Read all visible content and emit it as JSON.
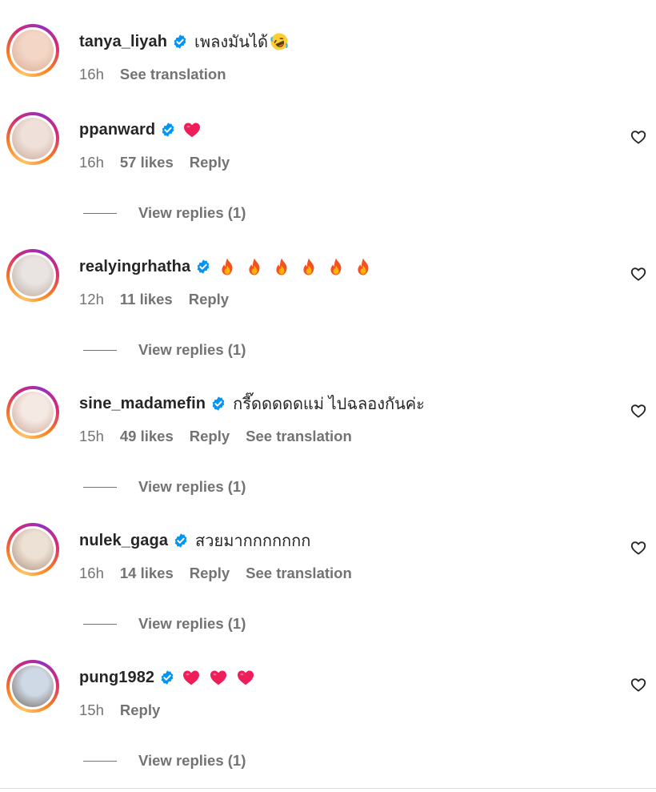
{
  "comments": [
    {
      "username": "tanya_liyah",
      "text": "เพลงมันได้",
      "emojis": [
        "rofl"
      ],
      "time": "16h",
      "likes": "",
      "reply": "",
      "translate": "See translation",
      "view_replies": "",
      "has_heart": false,
      "avatar_colors": [
        "#f3d6c6",
        "#d7a98e"
      ]
    },
    {
      "username": "ppanward",
      "text": "",
      "emojis": [
        "heart"
      ],
      "time": "16h",
      "likes": "57 likes",
      "reply": "Reply",
      "translate": "",
      "view_replies": "View replies (1)",
      "has_heart": true,
      "avatar_colors": [
        "#efe1d9",
        "#c8a396"
      ]
    },
    {
      "username": "realyingrhatha",
      "text": "",
      "emojis": [
        "fire",
        "fire",
        "fire",
        "fire",
        "fire",
        "fire"
      ],
      "time": "12h",
      "likes": "11 likes",
      "reply": "Reply",
      "translate": "",
      "view_replies": "View replies (1)",
      "has_heart": true,
      "avatar_colors": [
        "#e9e4e1",
        "#b9a69b"
      ]
    },
    {
      "username": "sine_madamefin",
      "text": "กรี๊ดดดดดแม่ ไปฉลองกันค่ะ",
      "emojis": [],
      "time": "15h",
      "likes": "49 likes",
      "reply": "Reply",
      "translate": "See translation",
      "view_replies": "View replies (1)",
      "has_heart": true,
      "avatar_colors": [
        "#f5e9e4",
        "#c9a28f"
      ]
    },
    {
      "username": "nulek_gaga",
      "text": "สวยมากกกกกกก",
      "emojis": [],
      "time": "16h",
      "likes": "14 likes",
      "reply": "Reply",
      "translate": "See translation",
      "view_replies": "View replies (1)",
      "has_heart": true,
      "avatar_colors": [
        "#ede0d4",
        "#a88c78"
      ]
    },
    {
      "username": "pung1982",
      "text": "",
      "emojis": [
        "heart",
        "heart",
        "heart"
      ],
      "time": "15h",
      "likes": "",
      "reply": "Reply",
      "translate": "",
      "view_replies": "View replies (1)",
      "has_heart": true,
      "avatar_colors": [
        "#cfd9e6",
        "#6d6258"
      ]
    }
  ],
  "colors": {
    "verified": "#0095f6",
    "heart": "#ed1e5a",
    "muted": "#737373",
    "text": "#262626"
  }
}
